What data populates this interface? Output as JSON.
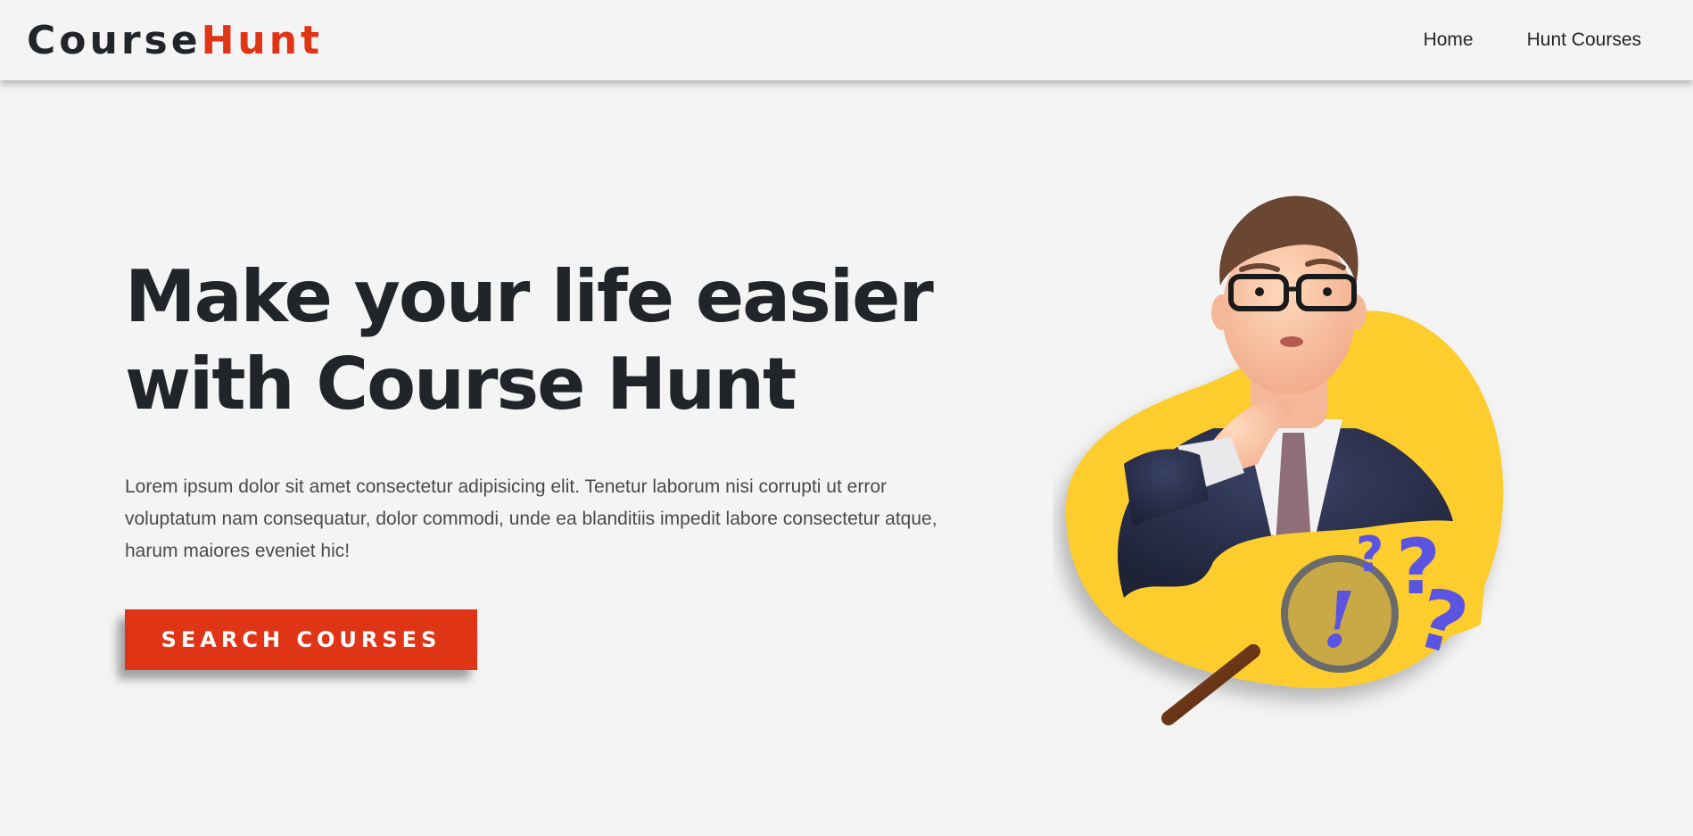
{
  "brand": {
    "name_part1": "Course",
    "name_part2": "Hunt",
    "accent_color": "#e03416",
    "dark_color": "#212529"
  },
  "nav": {
    "items": [
      {
        "label": "Home"
      },
      {
        "label": "Hunt Courses"
      }
    ]
  },
  "hero": {
    "title_line1": "Make your life easier",
    "title_line2": "with Course Hunt",
    "description": "Lorem ipsum dolor sit amet consectetur adipisicing elit. Tenetur laborum nisi corrupti ut error voluptatum nam consequatur, dolor commodi, unde ea blanditiis impedit labore consectetur atque, harum maiores eveniet hic!",
    "cta_label": "SEARCH COURSES",
    "illustration": {
      "icon": "thinking-businessman-illustration",
      "blob_color": "#fdcd2d",
      "question_mark_color": "#5a54e0"
    }
  }
}
